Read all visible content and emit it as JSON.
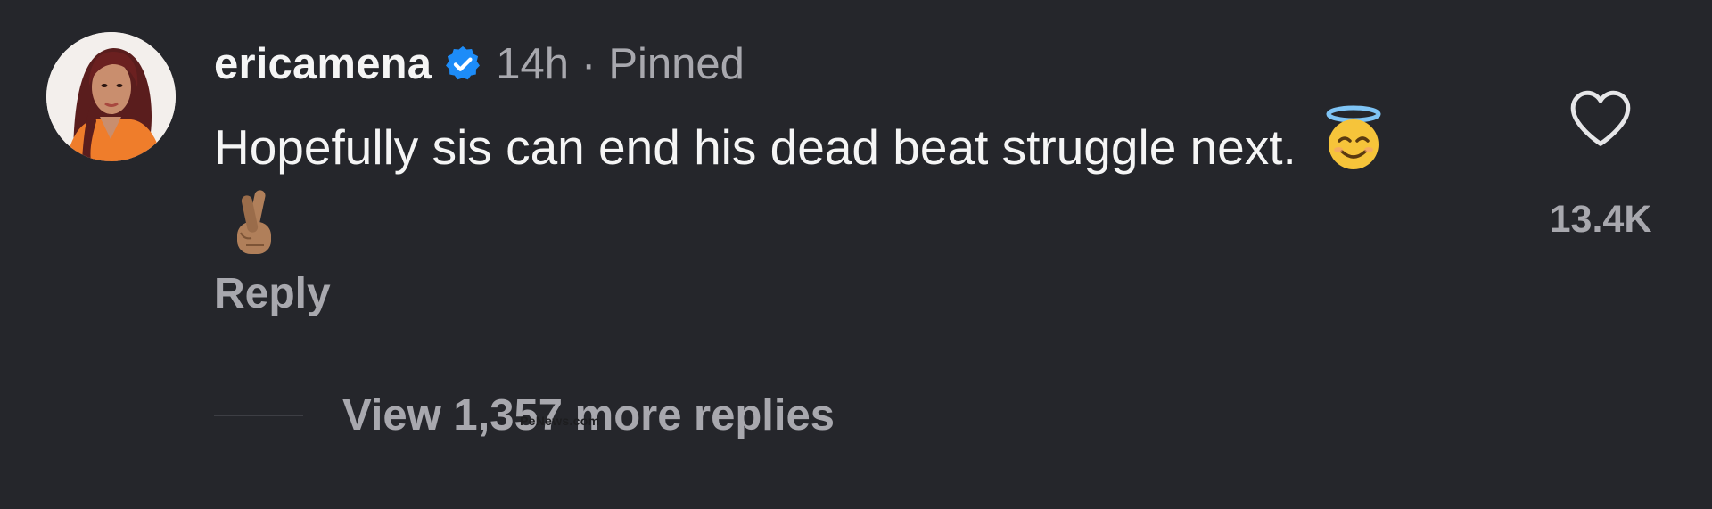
{
  "comment": {
    "username": "ericamena",
    "time": "14h",
    "separator": "·",
    "pinned_label": "Pinned",
    "text": "Hopefully sis can end his dead beat struggle next.",
    "emojis": [
      "smiling-face-with-halo",
      "crossed-fingers-medium-skin-tone"
    ],
    "reply_label": "Reply",
    "like_count": "13.4K",
    "view_replies_label": "View 1,357 more replies",
    "watermark": "PeNews.com"
  },
  "colors": {
    "background": "#25262b",
    "primary_text": "#f5f5f5",
    "secondary_text": "#a8a8ae",
    "verified_badge": "#1d8cf8"
  },
  "icons": {
    "verified": "verified-badge-icon",
    "like": "heart-outline-icon"
  }
}
